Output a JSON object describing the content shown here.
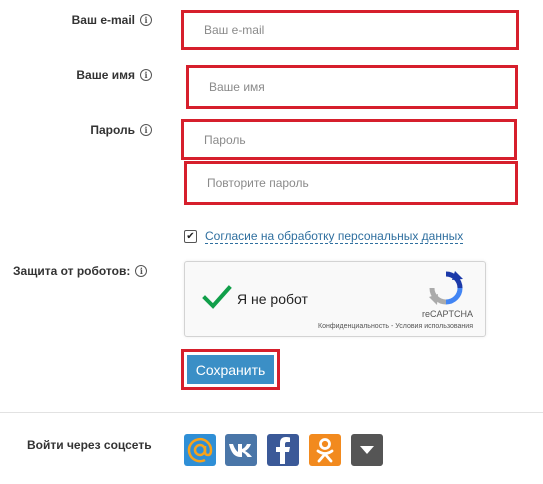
{
  "form": {
    "email": {
      "label": "Ваш e-mail",
      "placeholder": "Ваш e-mail"
    },
    "name": {
      "label": "Ваше имя",
      "placeholder": "Ваше имя"
    },
    "password": {
      "label": "Пароль",
      "placeholder": "Пароль"
    },
    "password_repeat": {
      "placeholder": "Повторите пароль"
    },
    "consent": {
      "checked": true,
      "label": "Согласие на обработку персональных данных"
    },
    "captcha": {
      "label": "Защита от роботов:",
      "checkbox_text": "Я не робот",
      "brand": "reCAPTCHA",
      "privacy": "Конфиденциальность",
      "separator": " - ",
      "terms": "Условия использования"
    },
    "save_label": "Сохранить"
  },
  "social": {
    "label": "Войти через соцсеть",
    "buttons": [
      {
        "name": "mailru",
        "icon": "at-icon",
        "color": "#2f8fd6"
      },
      {
        "name": "vk",
        "icon": "vk-icon",
        "color": "#4a76a8"
      },
      {
        "name": "facebook",
        "icon": "facebook-icon",
        "color": "#3b5998"
      },
      {
        "name": "odnoklassniki",
        "icon": "ok-icon",
        "color": "#f28a1e"
      },
      {
        "name": "more",
        "icon": "chevron-down-icon",
        "color": "#555555"
      }
    ]
  },
  "colors": {
    "highlight": "#d61f2c",
    "accent": "#3b8fc6",
    "link": "#2f6f9f"
  }
}
